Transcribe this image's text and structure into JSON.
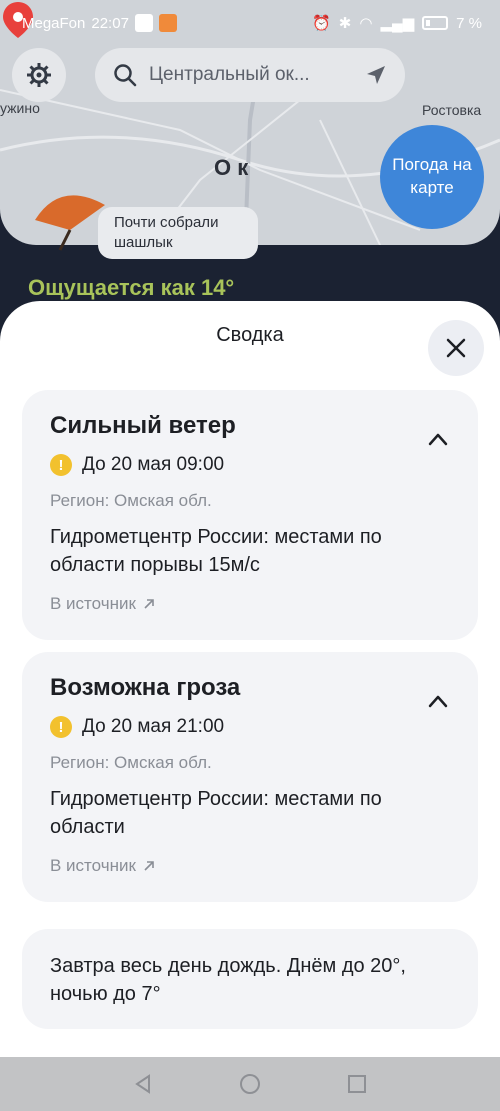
{
  "status_bar": {
    "carrier": "MegaFon",
    "time": "22:07",
    "battery": "7 %"
  },
  "map": {
    "search_placeholder": "Центральный ок...",
    "labels": {
      "left": "ужино",
      "right": "Ростовка",
      "city": "О к"
    },
    "weather_map_button": "Погода на карте",
    "mascot_bubble": "Почти собрали шашлык",
    "feels_like": "Ощущается как 14°"
  },
  "sheet": {
    "title": "Сводка",
    "alerts": [
      {
        "title": "Сильный ветер",
        "until": "До 20 мая 09:00",
        "region": "Регион: Омская обл.",
        "description": "Гидрометцентр России: местами по области порывы 15м/с",
        "source_link": "В источник"
      },
      {
        "title": "Возможна гроза",
        "until": "До 20 мая 21:00",
        "region": "Регион: Омская обл.",
        "description": "Гидрометцентр России: местами по области",
        "source_link": "В источник"
      }
    ],
    "forecast": "Завтра весь день дождь. Днём до 20°, ночью до 7°"
  },
  "colors": {
    "accent_blue": "#3e86d9",
    "warning_yellow": "#f2c12e",
    "card_bg": "#f3f4f7"
  },
  "icons": [
    "gear-icon",
    "search-icon",
    "location-arrow-icon",
    "map-pin-icon",
    "close-icon",
    "chevron-up-icon",
    "warning-icon",
    "external-link-icon",
    "back-icon",
    "home-icon",
    "recents-icon"
  ]
}
